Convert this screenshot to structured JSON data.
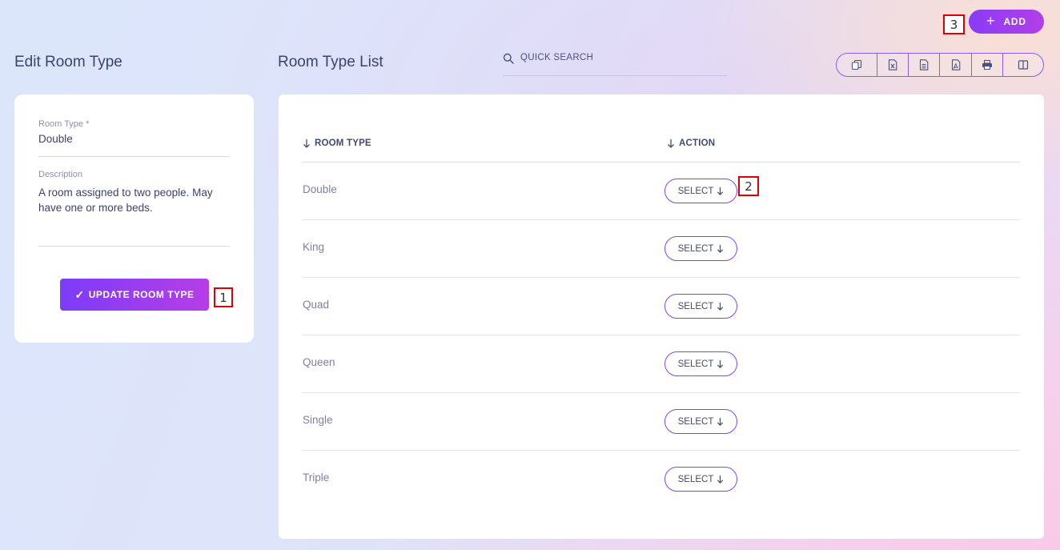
{
  "header": {
    "add_label": "ADD"
  },
  "edit_panel": {
    "title": "Edit Room Type",
    "room_type_label": "Room Type *",
    "room_type_value": "Double",
    "description_label": "Description",
    "description_value": "A room assigned to two people. May have one or more beds.",
    "update_label": "UPDATE ROOM TYPE",
    "update_icon": "✓"
  },
  "list_panel": {
    "title": "Room Type List",
    "search_placeholder": "QUICK SEARCH",
    "toolbar_icons": [
      "copy-icon",
      "excel-icon",
      "csv-icon",
      "pdf-icon",
      "print-icon",
      "columns-icon"
    ],
    "columns": [
      "ROOM TYPE",
      "ACTION"
    ],
    "rows": [
      {
        "name": "Double",
        "action": "SELECT"
      },
      {
        "name": "King",
        "action": "SELECT"
      },
      {
        "name": "Quad",
        "action": "SELECT"
      },
      {
        "name": "Queen",
        "action": "SELECT"
      },
      {
        "name": "Single",
        "action": "SELECT"
      },
      {
        "name": "Triple",
        "action": "SELECT"
      }
    ]
  },
  "markers": [
    "1",
    "2",
    "3"
  ],
  "colors": {
    "accent": "#7c3cf8",
    "accent_end": "#b63ee6",
    "text_dark": "#3b4272",
    "text_muted": "#7c82a0",
    "marker_border": "#e00000"
  }
}
